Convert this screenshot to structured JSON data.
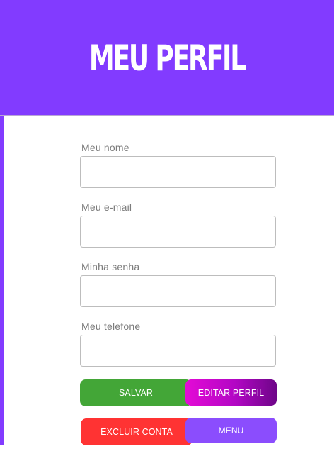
{
  "header": {
    "title": "MEU PERFIL"
  },
  "form": {
    "fields": [
      {
        "label": "Meu nome",
        "value": "",
        "placeholder": ""
      },
      {
        "label": "Meu e-mail",
        "value": "",
        "placeholder": ""
      },
      {
        "label": "Minha senha",
        "value": "",
        "placeholder": ""
      },
      {
        "label": "Meu telefone",
        "value": "",
        "placeholder": ""
      }
    ]
  },
  "actions": {
    "save_label": "SALVAR",
    "edit_label": "EDITAR PERFIL",
    "delete_label": "EXCLUIR CONTA",
    "menu_label": "MENU"
  },
  "colors": {
    "header_bg": "#823bff",
    "save": "#43a637",
    "edit_gradient_start": "#e40ad6",
    "edit_gradient_end": "#6e0588",
    "delete": "#ff3333",
    "menu": "#8b4dfd"
  }
}
